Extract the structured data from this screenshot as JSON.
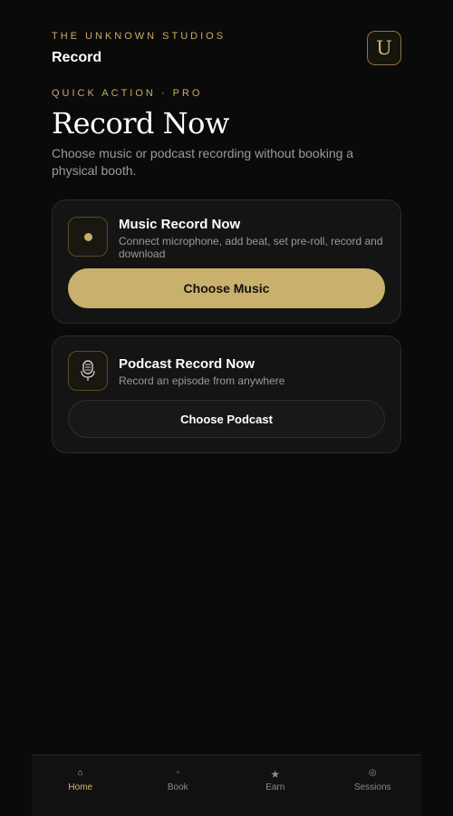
{
  "header": {
    "brand": "THE UNKNOWN STUDIOS",
    "section": "Record",
    "avatar_letter": "U"
  },
  "hero": {
    "eyebrow": "QUICK ACTION · PRO",
    "title": "Record Now",
    "subtitle": "Choose music or podcast recording without booking a physical booth."
  },
  "cards": [
    {
      "icon": "record-dot-icon",
      "title": "Music Record Now",
      "description": "Connect microphone, add beat, set pre-roll, record and download",
      "button": "Choose Music"
    },
    {
      "icon": "microphone-icon",
      "title": "Podcast Record Now",
      "description": "Record an episode from anywhere",
      "button": "Choose Podcast"
    }
  ],
  "tabbar": {
    "active": "Home",
    "items": [
      {
        "label": "Home",
        "icon": "home-icon",
        "glyph": "⌂"
      },
      {
        "label": "Book",
        "icon": "book-icon",
        "glyph": "▫"
      },
      {
        "label": "Earn",
        "icon": "star-icon",
        "glyph": "★"
      },
      {
        "label": "Sessions",
        "icon": "sessions-icon",
        "glyph": "◎"
      }
    ]
  },
  "colors": {
    "accent": "#c9ad67",
    "background": "#0a0a0a",
    "card": "#141414"
  }
}
